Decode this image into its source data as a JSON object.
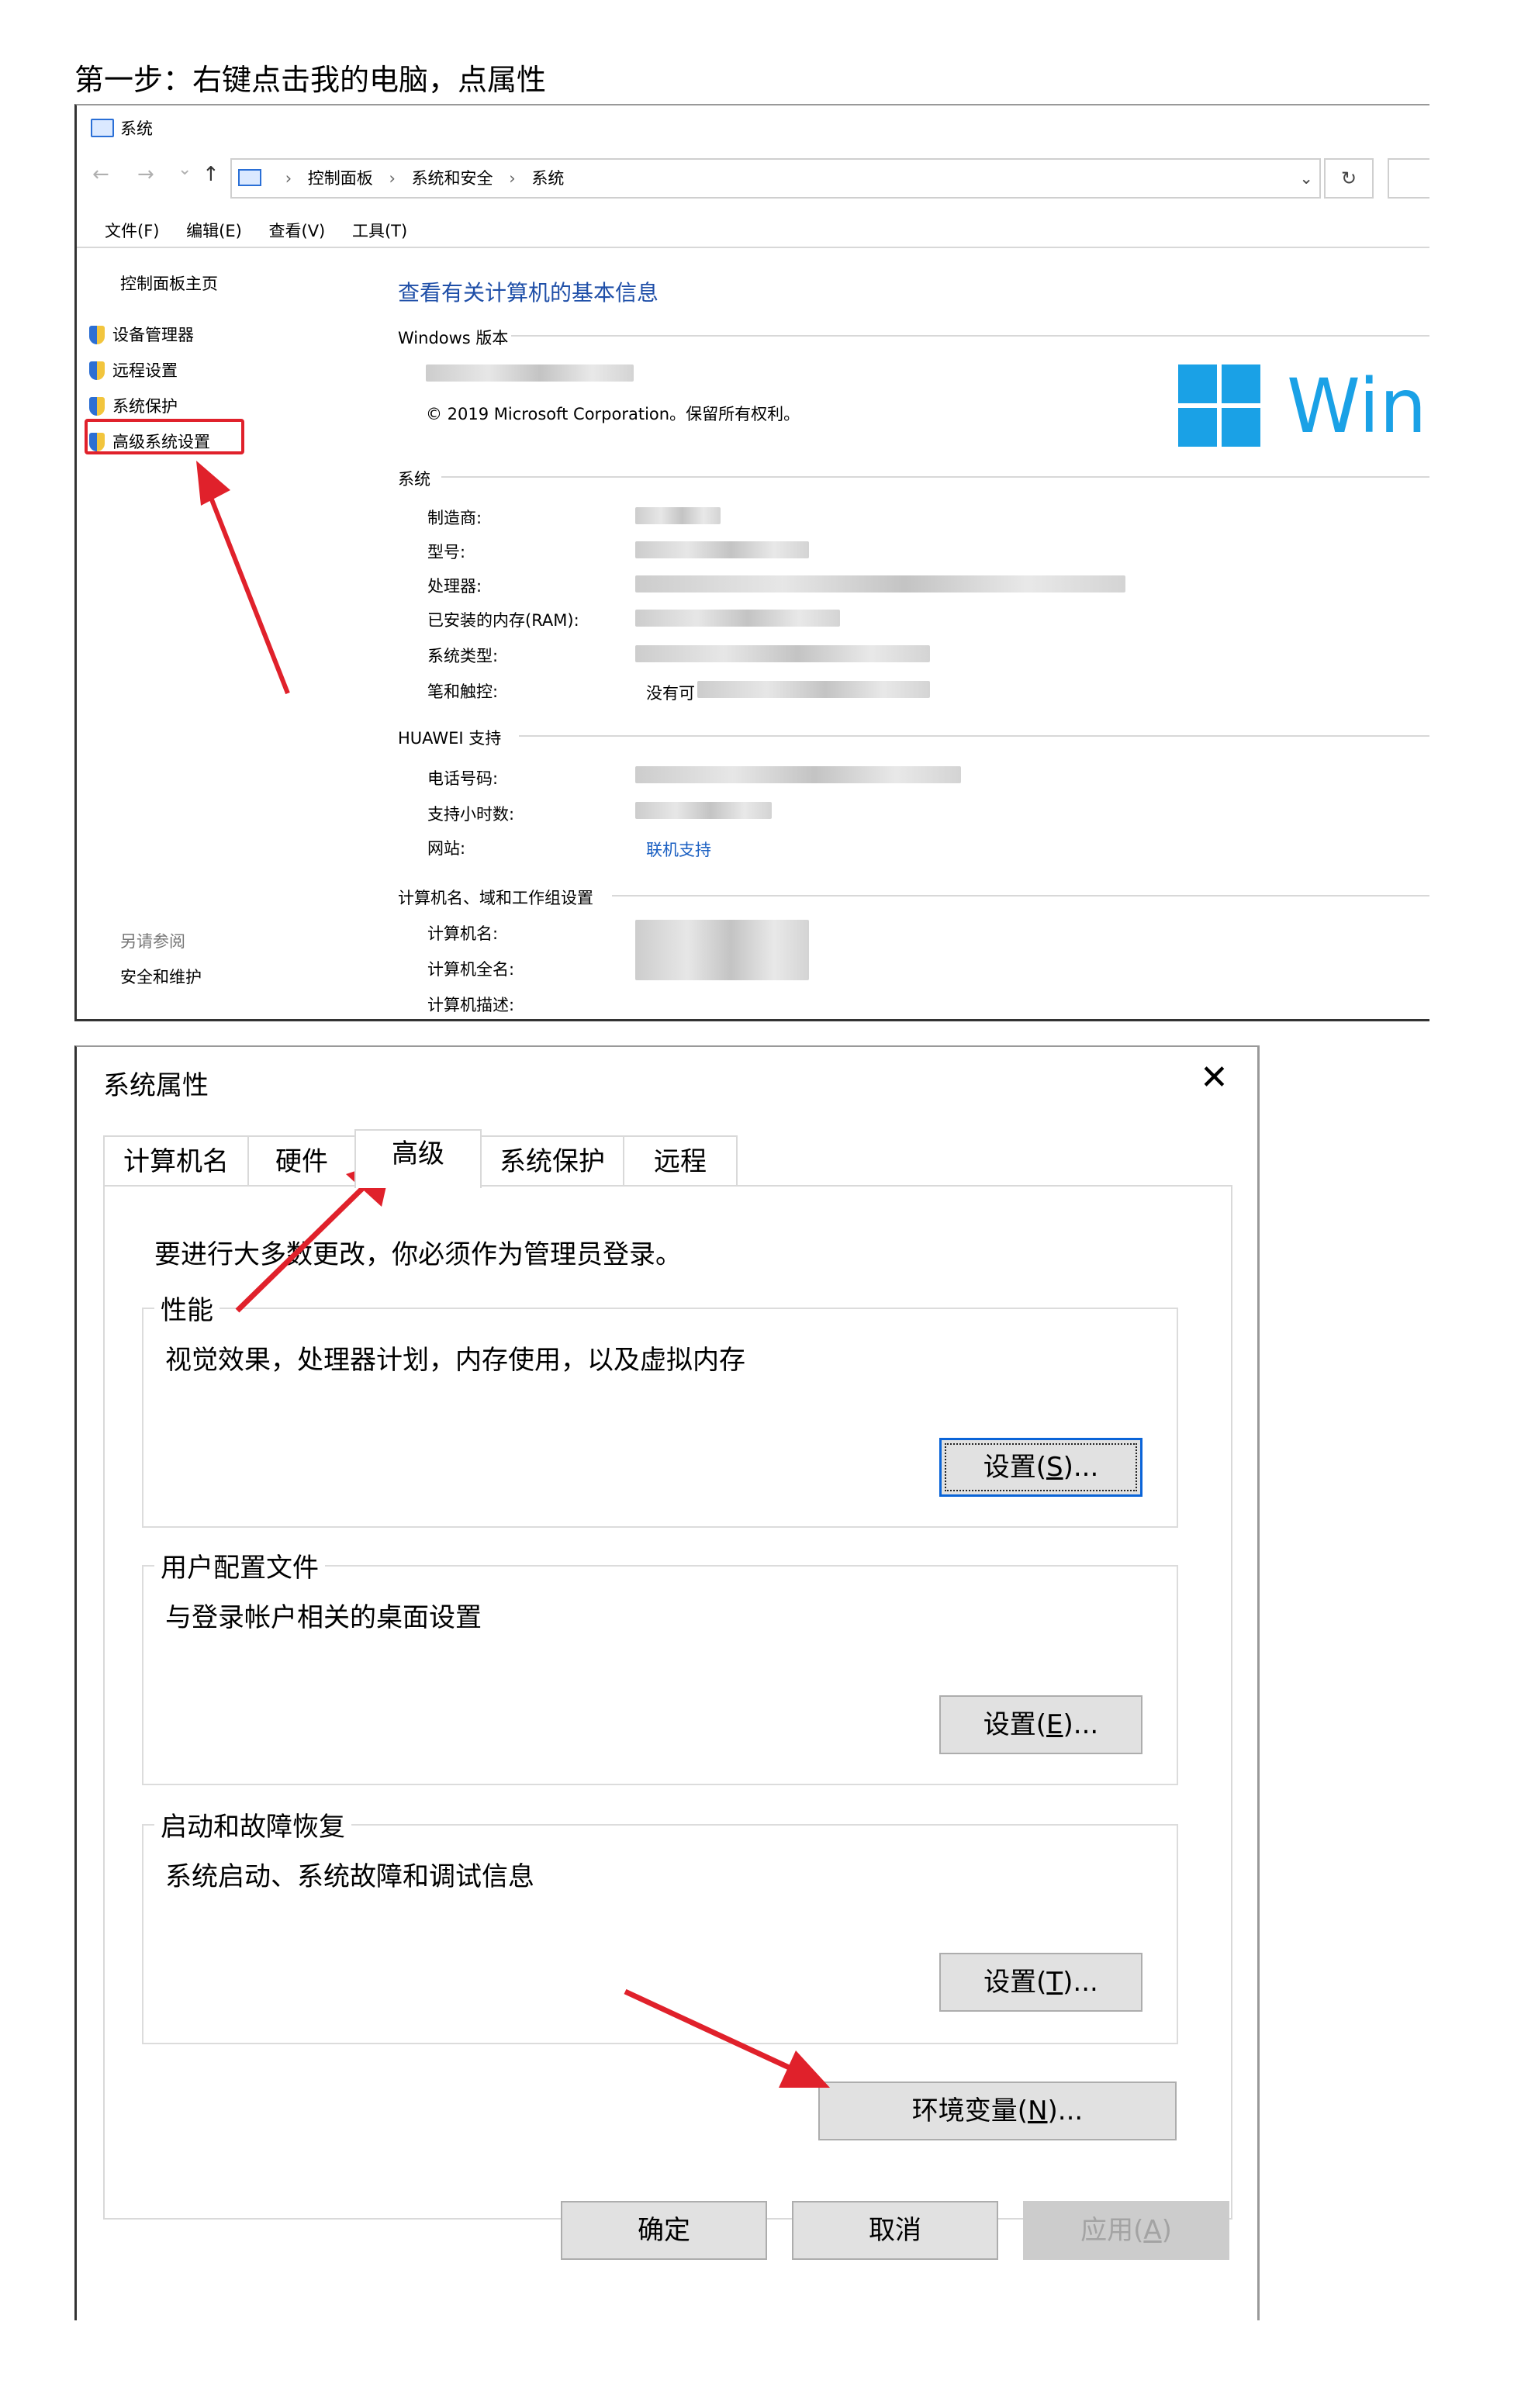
{
  "heading": "第一步：右键点击我的电脑，点属性",
  "system_window": {
    "title": "系统",
    "nav": {
      "back": "←",
      "forward": "→",
      "recent": "⌄",
      "up": "↑"
    },
    "breadcrumb": [
      "控制面板",
      "系统和安全",
      "系统"
    ],
    "breadcrumb_sep": "›",
    "dropdown": "⌄",
    "refresh": "↻",
    "menu": [
      "文件(F)",
      "编辑(E)",
      "查看(V)",
      "工具(T)"
    ],
    "sidebar": {
      "home": "控制面板主页",
      "items": [
        "设备管理器",
        "远程设置",
        "系统保护",
        "高级系统设置"
      ],
      "see_also": "另请参阅",
      "see_also_link": "安全和维护"
    },
    "main_title": "查看有关计算机的基本信息",
    "windows_edition": {
      "section": "Windows 版本",
      "copyright": "© 2019 Microsoft Corporation。保留所有权利。",
      "logo_text": "Winc"
    },
    "system": {
      "section": "系统",
      "labels": [
        "制造商:",
        "型号:",
        "处理器:",
        "已安装的内存(RAM):",
        "系统类型:",
        "笔和触控:"
      ],
      "pen_value_visible": "没有可"
    },
    "huawei": {
      "section": "HUAWEI 支持",
      "labels": [
        "电话号码:",
        "支持小时数:",
        "网站:"
      ],
      "website_link": "联机支持"
    },
    "computer_name": {
      "section": "计算机名、域和工作组设置",
      "labels": [
        "计算机名:",
        "计算机全名:",
        "计算机描述:"
      ]
    }
  },
  "dialog": {
    "title": "系统属性",
    "close": "✕",
    "tabs": [
      "计算机名",
      "硬件",
      "高级",
      "系统保护",
      "远程"
    ],
    "selected_tab": "高级",
    "admin_note": "要进行大多数更改，你必须作为管理员登录。",
    "groups": [
      {
        "label": "性能",
        "text": "视觉效果，处理器计划，内存使用，以及虚拟内存",
        "button": "设置(S)...",
        "btn_pre": "设置(",
        "btn_key": "S",
        "btn_post": ")..."
      },
      {
        "label": "用户配置文件",
        "text": "与登录帐户相关的桌面设置",
        "button": "设置(E)...",
        "btn_pre": "设置(",
        "btn_key": "E",
        "btn_post": ")..."
      },
      {
        "label": "启动和故障恢复",
        "text": "系统启动、系统故障和调试信息",
        "button": "设置(T)...",
        "btn_pre": "设置(",
        "btn_key": "T",
        "btn_post": ")..."
      }
    ],
    "env_button": {
      "pre": "环境变量(",
      "key": "N",
      "post": ")..."
    },
    "footer": {
      "ok": "确定",
      "cancel": "取消",
      "apply_pre": "应用(",
      "apply_key": "A",
      "apply_post": ")"
    }
  },
  "colors": {
    "annotation_red": "#e0212b",
    "link_blue": "#1a5fc2",
    "win_blue": "#1aa1e6",
    "focus_blue": "#0a64d8"
  }
}
